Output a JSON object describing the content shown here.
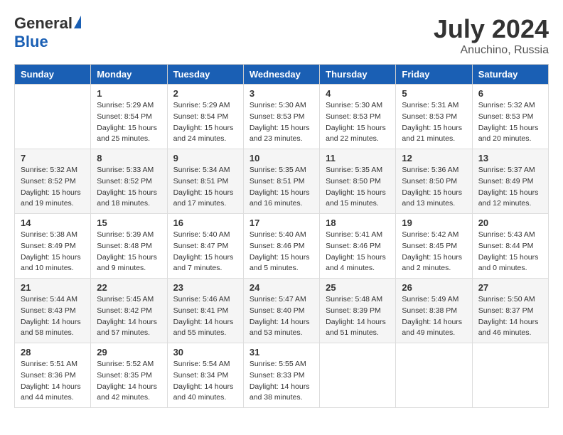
{
  "header": {
    "logo_general": "General",
    "logo_blue": "Blue",
    "month_title": "July 2024",
    "location": "Anuchino, Russia"
  },
  "days_of_week": [
    "Sunday",
    "Monday",
    "Tuesday",
    "Wednesday",
    "Thursday",
    "Friday",
    "Saturday"
  ],
  "weeks": [
    [
      {
        "day": "",
        "info": ""
      },
      {
        "day": "1",
        "info": "Sunrise: 5:29 AM\nSunset: 8:54 PM\nDaylight: 15 hours\nand 25 minutes."
      },
      {
        "day": "2",
        "info": "Sunrise: 5:29 AM\nSunset: 8:54 PM\nDaylight: 15 hours\nand 24 minutes."
      },
      {
        "day": "3",
        "info": "Sunrise: 5:30 AM\nSunset: 8:53 PM\nDaylight: 15 hours\nand 23 minutes."
      },
      {
        "day": "4",
        "info": "Sunrise: 5:30 AM\nSunset: 8:53 PM\nDaylight: 15 hours\nand 22 minutes."
      },
      {
        "day": "5",
        "info": "Sunrise: 5:31 AM\nSunset: 8:53 PM\nDaylight: 15 hours\nand 21 minutes."
      },
      {
        "day": "6",
        "info": "Sunrise: 5:32 AM\nSunset: 8:53 PM\nDaylight: 15 hours\nand 20 minutes."
      }
    ],
    [
      {
        "day": "7",
        "info": "Sunrise: 5:32 AM\nSunset: 8:52 PM\nDaylight: 15 hours\nand 19 minutes."
      },
      {
        "day": "8",
        "info": "Sunrise: 5:33 AM\nSunset: 8:52 PM\nDaylight: 15 hours\nand 18 minutes."
      },
      {
        "day": "9",
        "info": "Sunrise: 5:34 AM\nSunset: 8:51 PM\nDaylight: 15 hours\nand 17 minutes."
      },
      {
        "day": "10",
        "info": "Sunrise: 5:35 AM\nSunset: 8:51 PM\nDaylight: 15 hours\nand 16 minutes."
      },
      {
        "day": "11",
        "info": "Sunrise: 5:35 AM\nSunset: 8:50 PM\nDaylight: 15 hours\nand 15 minutes."
      },
      {
        "day": "12",
        "info": "Sunrise: 5:36 AM\nSunset: 8:50 PM\nDaylight: 15 hours\nand 13 minutes."
      },
      {
        "day": "13",
        "info": "Sunrise: 5:37 AM\nSunset: 8:49 PM\nDaylight: 15 hours\nand 12 minutes."
      }
    ],
    [
      {
        "day": "14",
        "info": "Sunrise: 5:38 AM\nSunset: 8:49 PM\nDaylight: 15 hours\nand 10 minutes."
      },
      {
        "day": "15",
        "info": "Sunrise: 5:39 AM\nSunset: 8:48 PM\nDaylight: 15 hours\nand 9 minutes."
      },
      {
        "day": "16",
        "info": "Sunrise: 5:40 AM\nSunset: 8:47 PM\nDaylight: 15 hours\nand 7 minutes."
      },
      {
        "day": "17",
        "info": "Sunrise: 5:40 AM\nSunset: 8:46 PM\nDaylight: 15 hours\nand 5 minutes."
      },
      {
        "day": "18",
        "info": "Sunrise: 5:41 AM\nSunset: 8:46 PM\nDaylight: 15 hours\nand 4 minutes."
      },
      {
        "day": "19",
        "info": "Sunrise: 5:42 AM\nSunset: 8:45 PM\nDaylight: 15 hours\nand 2 minutes."
      },
      {
        "day": "20",
        "info": "Sunrise: 5:43 AM\nSunset: 8:44 PM\nDaylight: 15 hours\nand 0 minutes."
      }
    ],
    [
      {
        "day": "21",
        "info": "Sunrise: 5:44 AM\nSunset: 8:43 PM\nDaylight: 14 hours\nand 58 minutes."
      },
      {
        "day": "22",
        "info": "Sunrise: 5:45 AM\nSunset: 8:42 PM\nDaylight: 14 hours\nand 57 minutes."
      },
      {
        "day": "23",
        "info": "Sunrise: 5:46 AM\nSunset: 8:41 PM\nDaylight: 14 hours\nand 55 minutes."
      },
      {
        "day": "24",
        "info": "Sunrise: 5:47 AM\nSunset: 8:40 PM\nDaylight: 14 hours\nand 53 minutes."
      },
      {
        "day": "25",
        "info": "Sunrise: 5:48 AM\nSunset: 8:39 PM\nDaylight: 14 hours\nand 51 minutes."
      },
      {
        "day": "26",
        "info": "Sunrise: 5:49 AM\nSunset: 8:38 PM\nDaylight: 14 hours\nand 49 minutes."
      },
      {
        "day": "27",
        "info": "Sunrise: 5:50 AM\nSunset: 8:37 PM\nDaylight: 14 hours\nand 46 minutes."
      }
    ],
    [
      {
        "day": "28",
        "info": "Sunrise: 5:51 AM\nSunset: 8:36 PM\nDaylight: 14 hours\nand 44 minutes."
      },
      {
        "day": "29",
        "info": "Sunrise: 5:52 AM\nSunset: 8:35 PM\nDaylight: 14 hours\nand 42 minutes."
      },
      {
        "day": "30",
        "info": "Sunrise: 5:54 AM\nSunset: 8:34 PM\nDaylight: 14 hours\nand 40 minutes."
      },
      {
        "day": "31",
        "info": "Sunrise: 5:55 AM\nSunset: 8:33 PM\nDaylight: 14 hours\nand 38 minutes."
      },
      {
        "day": "",
        "info": ""
      },
      {
        "day": "",
        "info": ""
      },
      {
        "day": "",
        "info": ""
      }
    ]
  ]
}
